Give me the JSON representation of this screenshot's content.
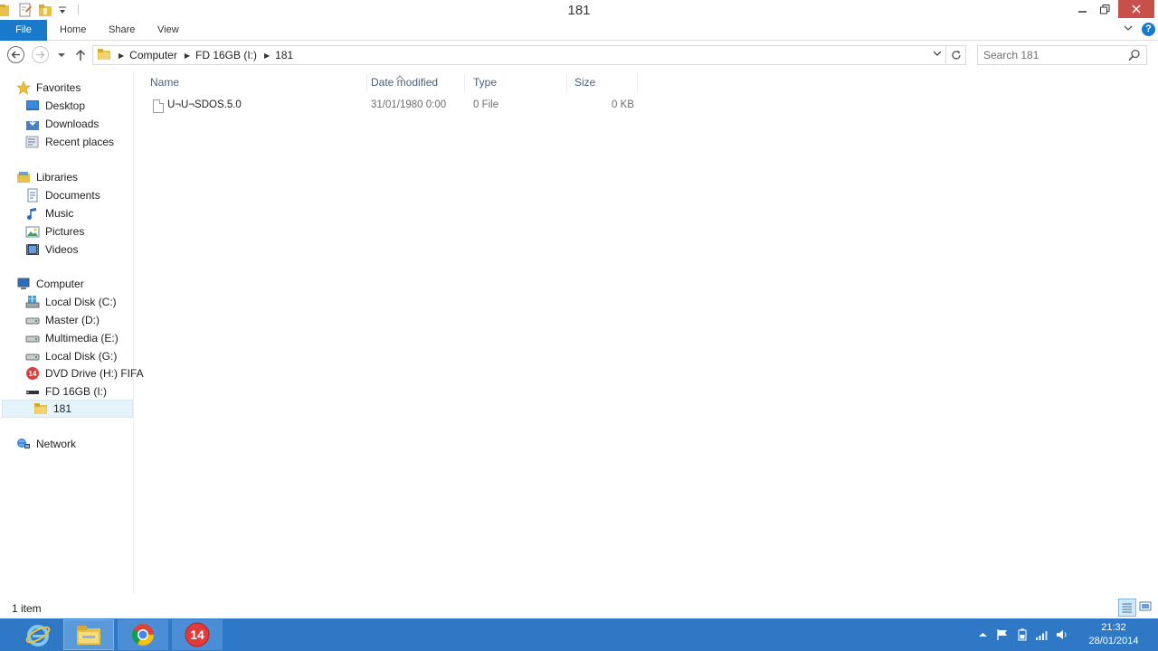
{
  "window": {
    "title": "181"
  },
  "ribbon": {
    "tabs": [
      "File",
      "Home",
      "Share",
      "View"
    ],
    "help": "?"
  },
  "address": {
    "crumbs": [
      "Computer",
      "FD 16GB (I:)",
      "181"
    ]
  },
  "search": {
    "placeholder": "Search 181"
  },
  "navpane": {
    "favorites": {
      "label": "Favorites",
      "items": [
        "Desktop",
        "Downloads",
        "Recent places"
      ]
    },
    "libraries": {
      "label": "Libraries",
      "items": [
        "Documents",
        "Music",
        "Pictures",
        "Videos"
      ]
    },
    "computer": {
      "label": "Computer",
      "items": [
        "Local Disk (C:)",
        "Master (D:)",
        "Multimedia (E:)",
        "Local Disk (G:)",
        "DVD Drive (H:) FIFA",
        "FD 16GB (I:)",
        "181"
      ]
    },
    "network": {
      "label": "Network"
    }
  },
  "columns": [
    "Name",
    "Date modified",
    "Type",
    "Size"
  ],
  "files": [
    {
      "name": "U¬U¬SDOS.5.0",
      "date": "31/01/1980 0:00",
      "type": "0 File",
      "size": "0 KB"
    }
  ],
  "status": {
    "item_count": "1 item"
  },
  "taskbar": {
    "apps": [
      "internet-explorer",
      "file-explorer",
      "chrome",
      "fifa-14"
    ],
    "fifa_label": "14",
    "time": "21:32",
    "date": "28/01/2014"
  },
  "colors": {
    "accent": "#1979ca",
    "taskbar": "#2e78c6",
    "close": "#c7504a",
    "selection": "#e5f3fb"
  }
}
